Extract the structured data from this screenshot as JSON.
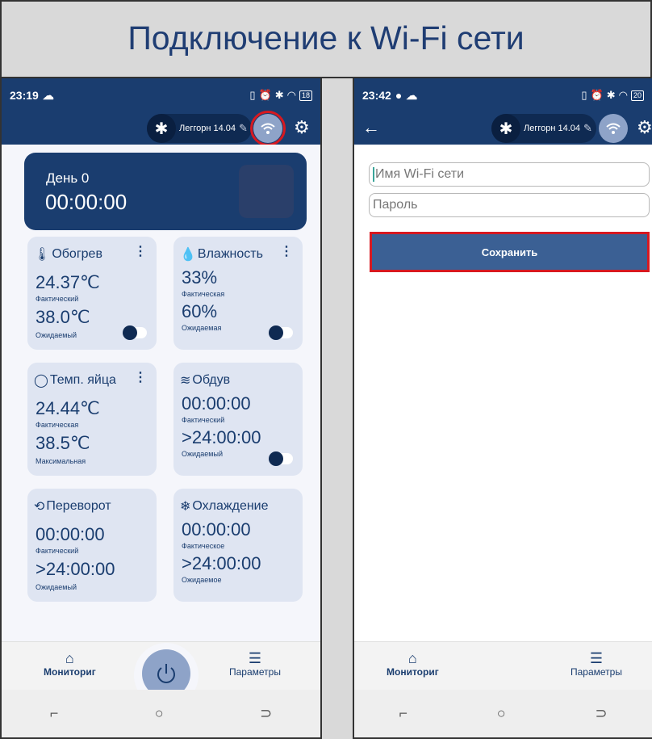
{
  "page_title": "Подключение к Wi-Fi сети",
  "colors": {
    "primary": "#1a3d6f",
    "card_bg": "#dfe5f2",
    "highlight": "#d71920",
    "wifi_button": "#8ea3c8"
  },
  "screen1": {
    "status": {
      "time": "23:19",
      "battery": "18"
    },
    "toolbar": {
      "device_name": "Леггорн 14.04"
    },
    "day": {
      "label": "День 0",
      "time": "00:00:00"
    },
    "cards": {
      "heating": {
        "title": "Обогрев",
        "actual": "24.37℃",
        "actual_label": "Фактический",
        "expected": "38.0℃",
        "expected_label": "Ожидаемый"
      },
      "humidity": {
        "title": "Влажность",
        "actual": "33%",
        "actual_label": "Фактическая",
        "expected": "60%",
        "expected_label": "Ожидаемая"
      },
      "egg_temp": {
        "title": "Темп. яйца",
        "actual": "24.44℃",
        "actual_label": "Фактическая",
        "expected": "38.5℃",
        "expected_label": "Максимальная"
      },
      "airflow": {
        "title": "Обдув",
        "actual": "00:00:00",
        "actual_label": "Фактический",
        "expected": ">24:00:00",
        "expected_label": "Ожидаемый"
      },
      "turning": {
        "title": "Переворот",
        "actual": "00:00:00",
        "actual_label": "Фактический",
        "expected": ">24:00:00",
        "expected_label": "Ожидаемый"
      },
      "cooling": {
        "title": "Охлаждение",
        "actual": "00:00:00",
        "actual_label": "Фактическое",
        "expected": ">24:00:00",
        "expected_label": "Ожидаемое"
      }
    },
    "nav": {
      "monitoring": "Мониториг",
      "parameters": "Параметры"
    }
  },
  "screen2": {
    "status": {
      "time": "23:42",
      "battery": "20"
    },
    "toolbar": {
      "device_name": "Леггорн 14.04"
    },
    "form": {
      "ssid_placeholder": "Имя Wi-Fi сети",
      "password_placeholder": "Пароль",
      "save_label": "Сохранить"
    },
    "nav": {
      "monitoring": "Мониториг",
      "parameters": "Параметры"
    }
  }
}
